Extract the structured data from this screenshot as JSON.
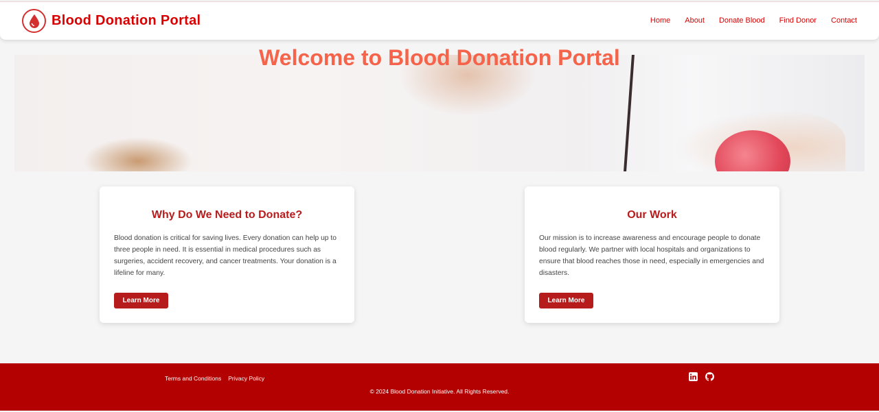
{
  "header": {
    "brand": "Blood Donation Portal",
    "logo_icon": "blood-drop-icon",
    "nav": [
      "Home",
      "About",
      "Donate Blood",
      "Find Donor",
      "Contact"
    ]
  },
  "hero": {
    "title": "Welcome to Blood Donation Portal"
  },
  "cards": [
    {
      "title": "Why Do We Need to Donate?",
      "text": "Blood donation is critical for saving lives. Every donation can help up to three people in need. It is essential in medical procedures such as surgeries, accident recovery, and cancer treatments. Your donation is a lifeline for many.",
      "button": "Learn More"
    },
    {
      "title": "Our Work",
      "text": "Our mission is to increase awareness and encourage people to donate blood regularly. We partner with local hospitals and organizations to ensure that blood reaches those in need, especially in emergencies and disasters.",
      "button": "Learn More"
    }
  ],
  "footer": {
    "links": [
      "Terms and Conditions",
      "Privacy Policy"
    ],
    "social_icons": [
      "linkedin-icon",
      "github-icon"
    ],
    "copyright": "© 2024 Blood Donation Initiative. All Rights Reserved."
  },
  "colors": {
    "brand_red": "#d80000",
    "button_red": "#b71c1c",
    "footer_red": "#b30000",
    "hero_title": "#f4634a"
  }
}
